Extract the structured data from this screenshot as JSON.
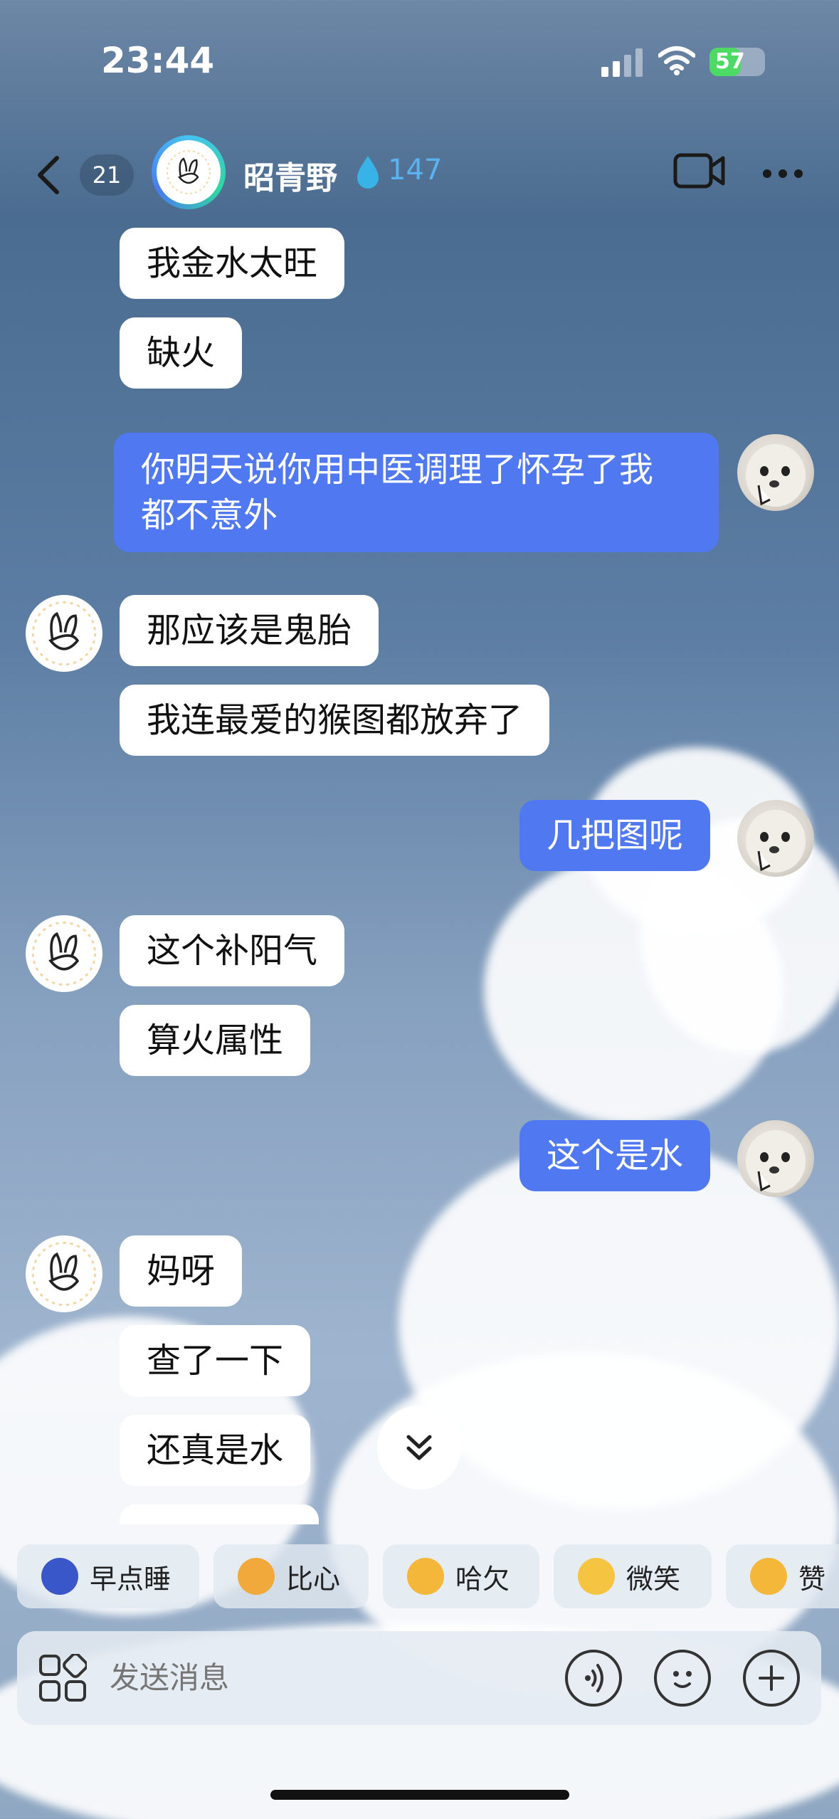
{
  "status": {
    "time": "23:44",
    "battery": "57",
    "battery_level": 0.57
  },
  "header": {
    "unread_count": "21",
    "peer_name": "昭青野",
    "water_count": "147"
  },
  "messages": [
    {
      "dir": "in",
      "text": "我金水太旺"
    },
    {
      "dir": "in",
      "text": "缺火"
    },
    {
      "dir": "out",
      "text": "你明天说你用中医调理了怀孕了我\n都不意外"
    },
    {
      "dir": "in",
      "text": "那应该是鬼胎"
    },
    {
      "dir": "in",
      "text": "我连最爱的猴图都放弃了"
    },
    {
      "dir": "out",
      "text": "几把图呢"
    },
    {
      "dir": "in",
      "text": "这个补阳气"
    },
    {
      "dir": "in",
      "text": "算火属性"
    },
    {
      "dir": "out",
      "text": "这个是水"
    },
    {
      "dir": "in",
      "text": "妈呀"
    },
    {
      "dir": "in",
      "text": "查了一下"
    },
    {
      "dir": "in",
      "text": "还真是水"
    }
  ],
  "quick_replies": [
    {
      "label": "早点睡",
      "color": "#3a57c9"
    },
    {
      "label": "比心",
      "color": "#f2a93b"
    },
    {
      "label": "哈欠",
      "color": "#f5b73a"
    },
    {
      "label": "微笑",
      "color": "#f5c542"
    },
    {
      "label": "赞",
      "color": "#f5b73a"
    }
  ],
  "input": {
    "placeholder": "发送消息"
  },
  "icons": {
    "back": "chevron-left-icon",
    "video": "video-camera-icon",
    "more": "more-dots-icon",
    "apps": "apps-grid-icon",
    "voice": "voice-icon",
    "emoji": "emoji-icon",
    "plus": "plus-icon",
    "scroll": "double-chevron-down-icon"
  },
  "colors": {
    "outgoing_bubble": "#5078f0",
    "incoming_bubble": "#ffffff"
  }
}
